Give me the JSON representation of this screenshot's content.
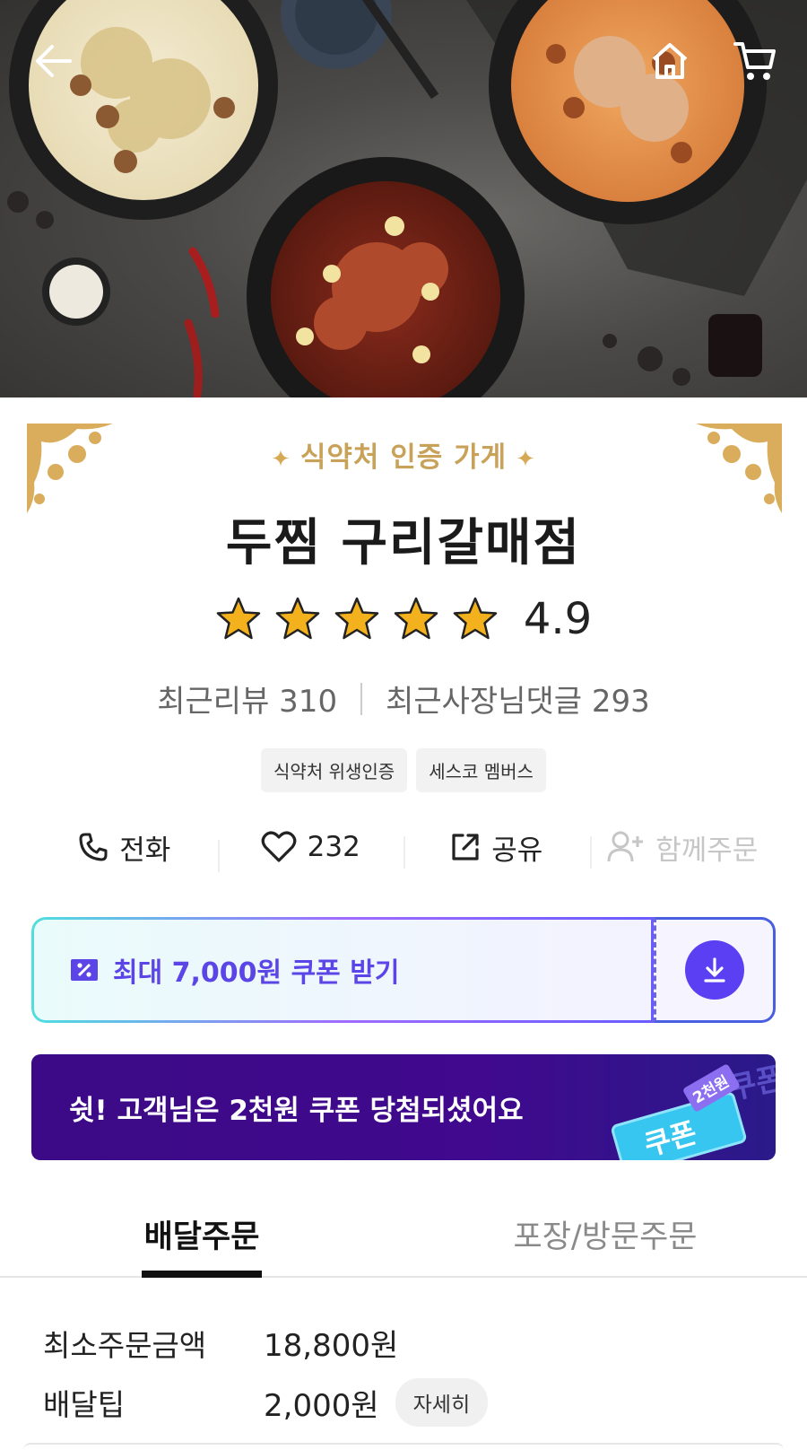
{
  "header": {
    "back_icon": "arrow-left-icon",
    "home_icon": "home-icon",
    "cart_icon": "cart-icon"
  },
  "store": {
    "certification": "식약처 인증 가게",
    "name": "두찜 구리갈매점",
    "rating": "4.9",
    "rating_stars": 5,
    "recent_reviews": "최근리뷰 310",
    "owner_replies": "최근사장님댓글 293",
    "tags": [
      "식약처 위생인증",
      "세스코 멤버스"
    ]
  },
  "actions": {
    "call": "전화",
    "likes": "232",
    "share": "공유",
    "group_order": "함께주문"
  },
  "coupon": {
    "label": "최대 7,000원 쿠폰 받기",
    "accent": "#5b45e6"
  },
  "promo": {
    "text": "쉿! 고객님은 2천원 쿠폰 당첨되셨어요",
    "ticket_label": "쿠폰",
    "ticket_badge": "2천원",
    "ticket_bg_text": "쿠폰"
  },
  "tabs": [
    {
      "label": "배달주문",
      "active": true
    },
    {
      "label": "포장/방문주문",
      "active": false
    }
  ],
  "order_info": {
    "min_order_label": "최소주문금액",
    "min_order_value": "18,800원",
    "delivery_tip_label": "배달팁",
    "delivery_tip_value": "2,000원",
    "detail_button": "자세히"
  }
}
